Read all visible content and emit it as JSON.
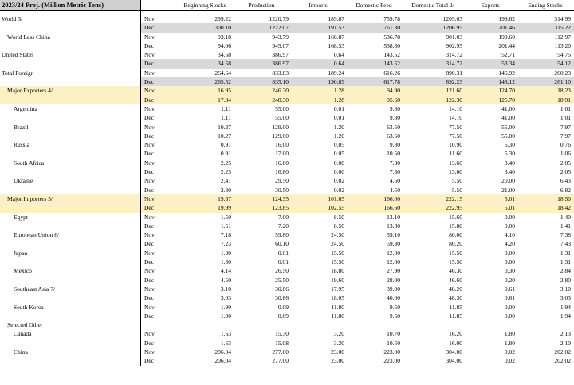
{
  "title": "2023/24 Proj. (Million Metric Tons)",
  "columns": [
    "Beginning Stocks",
    "Production",
    "Imports",
    "Domestic Feed",
    "Domestic Total 2/",
    "Exports",
    "Ending Stocks"
  ],
  "rows": [
    {
      "region": "World  3/",
      "level": 0,
      "style": "",
      "month": "Nov",
      "values": [
        "299.22",
        "1220.79",
        "189.87",
        "759.78",
        "1205.03",
        "199.62",
        "314.99"
      ]
    },
    {
      "region": "",
      "level": 0,
      "style": "grey",
      "month": "Dec",
      "values": [
        "300.10",
        "1222.07",
        "191.53",
        "761.30",
        "1206.95",
        "201.46",
        "315.22"
      ]
    },
    {
      "region": "World Less China",
      "level": 1,
      "style": "",
      "month": "Nov",
      "values": [
        "93.18",
        "943.79",
        "166.87",
        "536.78",
        "901.03",
        "199.60",
        "112.97"
      ]
    },
    {
      "region": "",
      "level": 1,
      "style": "",
      "month": "Dec",
      "values": [
        "94.06",
        "945.07",
        "168.53",
        "538.30",
        "902.95",
        "201.44",
        "113.20"
      ]
    },
    {
      "region": "United States",
      "level": 0,
      "style": "",
      "month": "Nov",
      "values": [
        "34.58",
        "386.97",
        "0.64",
        "143.52",
        "314.72",
        "52.71",
        "54.75"
      ]
    },
    {
      "region": "",
      "level": 0,
      "style": "grey",
      "month": "Dec",
      "values": [
        "34.58",
        "386.97",
        "0.64",
        "143.52",
        "314.72",
        "53.34",
        "54.12"
      ]
    },
    {
      "region": "Total Foreign",
      "level": 0,
      "style": "",
      "month": "Nov",
      "values": [
        "264.64",
        "833.83",
        "189.24",
        "616.26",
        "890.31",
        "146.92",
        "260.23"
      ]
    },
    {
      "region": "",
      "level": 0,
      "style": "grey",
      "month": "Dec",
      "values": [
        "265.52",
        "835.10",
        "190.89",
        "617.78",
        "892.23",
        "148.12",
        "261.10"
      ]
    },
    {
      "region": "Major Exporters  4/",
      "level": 1,
      "style": "yellow",
      "month": "Nov",
      "values": [
        "16.95",
        "246.30",
        "1.28",
        "94.90",
        "121.60",
        "124.70",
        "18.23"
      ]
    },
    {
      "region": "",
      "level": 1,
      "style": "yellow",
      "month": "Dec",
      "values": [
        "17.34",
        "248.30",
        "1.28",
        "95.60",
        "122.30",
        "125.70",
        "18.91"
      ]
    },
    {
      "region": "Argentina",
      "level": 2,
      "style": "",
      "month": "Nov",
      "values": [
        "1.11",
        "55.00",
        "0.01",
        "9.80",
        "14.10",
        "41.00",
        "1.01"
      ]
    },
    {
      "region": "",
      "level": 2,
      "style": "",
      "month": "Dec",
      "values": [
        "1.11",
        "55.00",
        "0.01",
        "9.80",
        "14.10",
        "41.00",
        "1.01"
      ]
    },
    {
      "region": "Brazil",
      "level": 2,
      "style": "",
      "month": "Nov",
      "values": [
        "10.27",
        "129.00",
        "1.20",
        "63.50",
        "77.50",
        "55.00",
        "7.97"
      ]
    },
    {
      "region": "",
      "level": 2,
      "style": "",
      "month": "Dec",
      "values": [
        "10.27",
        "129.00",
        "1.20",
        "63.50",
        "77.50",
        "55.00",
        "7.97"
      ]
    },
    {
      "region": "Russia",
      "level": 2,
      "style": "",
      "month": "Nov",
      "values": [
        "0.91",
        "16.00",
        "0.05",
        "9.80",
        "10.90",
        "5.30",
        "0.76"
      ]
    },
    {
      "region": "",
      "level": 2,
      "style": "",
      "month": "Dec",
      "values": [
        "0.91",
        "17.00",
        "0.05",
        "10.50",
        "11.60",
        "5.30",
        "1.06"
      ]
    },
    {
      "region": "South Africa",
      "level": 2,
      "style": "",
      "month": "Nov",
      "values": [
        "2.25",
        "16.80",
        "0.00",
        "7.30",
        "13.60",
        "3.40",
        "2.05"
      ]
    },
    {
      "region": "",
      "level": 2,
      "style": "",
      "month": "Dec",
      "values": [
        "2.25",
        "16.80",
        "0.00",
        "7.30",
        "13.60",
        "3.40",
        "2.05"
      ]
    },
    {
      "region": "Ukraine",
      "level": 2,
      "style": "",
      "month": "Nov",
      "values": [
        "2.41",
        "29.50",
        "0.02",
        "4.50",
        "5.50",
        "20.00",
        "6.43"
      ]
    },
    {
      "region": "",
      "level": 2,
      "style": "",
      "month": "Dec",
      "values": [
        "2.80",
        "30.50",
        "0.02",
        "4.50",
        "5.50",
        "21.00",
        "6.82"
      ]
    },
    {
      "region": "Major Importers  5/",
      "level": 1,
      "style": "yellow",
      "month": "Nov",
      "values": [
        "19.67",
        "124.35",
        "101.65",
        "166.00",
        "222.15",
        "5.01",
        "18.50"
      ]
    },
    {
      "region": "",
      "level": 1,
      "style": "yellow",
      "month": "Dec",
      "values": [
        "19.99",
        "123.85",
        "102.55",
        "166.60",
        "222.95",
        "5.01",
        "18.42"
      ]
    },
    {
      "region": "Egypt",
      "level": 2,
      "style": "",
      "month": "Nov",
      "values": [
        "1.50",
        "7.00",
        "8.50",
        "13.10",
        "15.60",
        "0.00",
        "1.40"
      ]
    },
    {
      "region": "",
      "level": 2,
      "style": "",
      "month": "Dec",
      "values": [
        "1.51",
        "7.20",
        "8.50",
        "13.30",
        "15.80",
        "0.00",
        "1.41"
      ]
    },
    {
      "region": "European Union  6/",
      "level": 2,
      "style": "",
      "month": "Nov",
      "values": [
        "7.18",
        "59.80",
        "24.50",
        "59.10",
        "80.00",
        "4.10",
        "7.38"
      ]
    },
    {
      "region": "",
      "level": 2,
      "style": "",
      "month": "Dec",
      "values": [
        "7.23",
        "60.10",
        "24.50",
        "59.30",
        "80.20",
        "4.20",
        "7.43"
      ]
    },
    {
      "region": "Japan",
      "level": 2,
      "style": "",
      "month": "Nov",
      "values": [
        "1.30",
        "0.01",
        "15.50",
        "12.00",
        "15.50",
        "0.00",
        "1.31"
      ]
    },
    {
      "region": "",
      "level": 2,
      "style": "",
      "month": "Dec",
      "values": [
        "1.30",
        "0.01",
        "15.50",
        "12.00",
        "15.50",
        "0.00",
        "1.31"
      ]
    },
    {
      "region": "Mexico",
      "level": 2,
      "style": "",
      "month": "Nov",
      "values": [
        "4.14",
        "26.50",
        "18.80",
        "27.90",
        "46.30",
        "0.30",
        "2.84"
      ]
    },
    {
      "region": "",
      "level": 2,
      "style": "",
      "month": "Dec",
      "values": [
        "4.50",
        "25.50",
        "19.60",
        "28.00",
        "46.60",
        "0.20",
        "2.80"
      ]
    },
    {
      "region": "Southeast Asia  7/",
      "level": 2,
      "style": "",
      "month": "Nov",
      "values": [
        "3.10",
        "30.86",
        "17.95",
        "39.90",
        "48.20",
        "0.61",
        "3.10"
      ]
    },
    {
      "region": "",
      "level": 2,
      "style": "",
      "month": "Dec",
      "values": [
        "3.03",
        "30.86",
        "18.05",
        "40.00",
        "48.30",
        "0.61",
        "3.03"
      ]
    },
    {
      "region": "South Korea",
      "level": 2,
      "style": "",
      "month": "Nov",
      "values": [
        "1.90",
        "0.09",
        "11.80",
        "9.50",
        "11.85",
        "0.00",
        "1.94"
      ]
    },
    {
      "region": "",
      "level": 2,
      "style": "",
      "month": "Dec",
      "values": [
        "1.90",
        "0.09",
        "11.80",
        "9.50",
        "11.85",
        "0.00",
        "1.94"
      ]
    },
    {
      "region": "Selected Other",
      "level": 1,
      "style": "",
      "month": "",
      "values": [
        "",
        "",
        "",
        "",
        "",
        "",
        ""
      ]
    },
    {
      "region": "Canada",
      "level": 2,
      "style": "",
      "month": "Nov",
      "values": [
        "1.63",
        "15.30",
        "3.20",
        "10.70",
        "16.20",
        "1.80",
        "2.13"
      ]
    },
    {
      "region": "",
      "level": 2,
      "style": "",
      "month": "Dec",
      "values": [
        "1.63",
        "15.08",
        "3.20",
        "10.50",
        "16.00",
        "1.80",
        "2.10"
      ]
    },
    {
      "region": "China",
      "level": 2,
      "style": "",
      "month": "Nov",
      "values": [
        "206.04",
        "277.00",
        "23.00",
        "223.00",
        "304.00",
        "0.02",
        "202.02"
      ]
    },
    {
      "region": "",
      "level": 2,
      "style": "",
      "month": "Dec",
      "values": [
        "206.04",
        "277.00",
        "23.00",
        "223.00",
        "304.00",
        "0.02",
        "202.02"
      ]
    }
  ]
}
